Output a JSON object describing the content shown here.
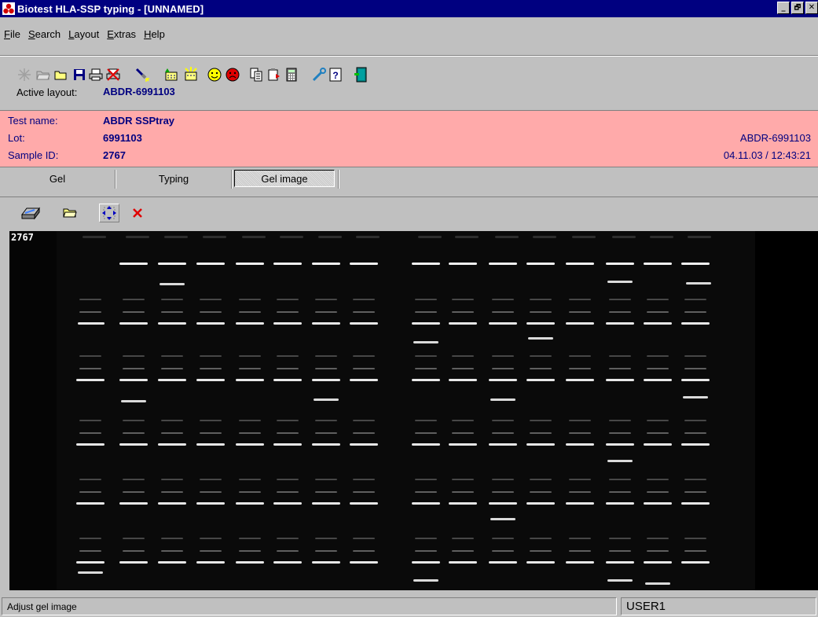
{
  "window": {
    "title": "Biotest HLA-SSP typing - [UNNAMED]",
    "controls": [
      "_",
      "🗗",
      "✕"
    ]
  },
  "menu": [
    {
      "accel": "F",
      "rest": "ile"
    },
    {
      "accel": "S",
      "rest": "earch"
    },
    {
      "accel": "L",
      "rest": "ayout"
    },
    {
      "accel": "E",
      "rest": "xtras"
    },
    {
      "accel": "H",
      "rest": "elp"
    }
  ],
  "toolbar": {
    "icons": [
      "new-icon",
      "open-folder-icon",
      "folder-icon",
      "save-icon",
      "print-icon",
      "delete-icon",
      "flashlight-icon",
      "import-icon",
      "export-icon",
      "positive-icon",
      "negative-icon",
      "copy-icon",
      "paste-icon",
      "calculator-icon",
      "wrench-icon",
      "help-icon",
      "exit-icon"
    ]
  },
  "active_layout": {
    "label": "Active layout:",
    "value": "ABDR-6991103"
  },
  "info": {
    "test_name_label": "Test name:",
    "test_name": "ABDR SSPtray",
    "lot_label": "Lot:",
    "lot": "6991103",
    "sample_label": "Sample ID:",
    "sample": "2767",
    "layout_right": "ABDR-6991103",
    "datetime": "04.11.03 / 12:43:21"
  },
  "tabs": [
    {
      "label": "Gel",
      "active": false
    },
    {
      "label": "Typing",
      "active": false
    },
    {
      "label": "Gel image",
      "active": true
    }
  ],
  "gel_toolbar": {
    "icons": [
      "scanner-icon",
      "open-folder-icon",
      "move-arrows-icon",
      "close-icon"
    ]
  },
  "gel": {
    "sample_label": "2767",
    "lanes": 17,
    "rows": 6
  },
  "status": {
    "message": "Adjust gel image",
    "user": "USER1"
  },
  "colors": {
    "title_bg": "#000080",
    "info_bg": "#ffaaaa",
    "info_text": "#000080",
    "window_bg": "#c0c0c0"
  }
}
